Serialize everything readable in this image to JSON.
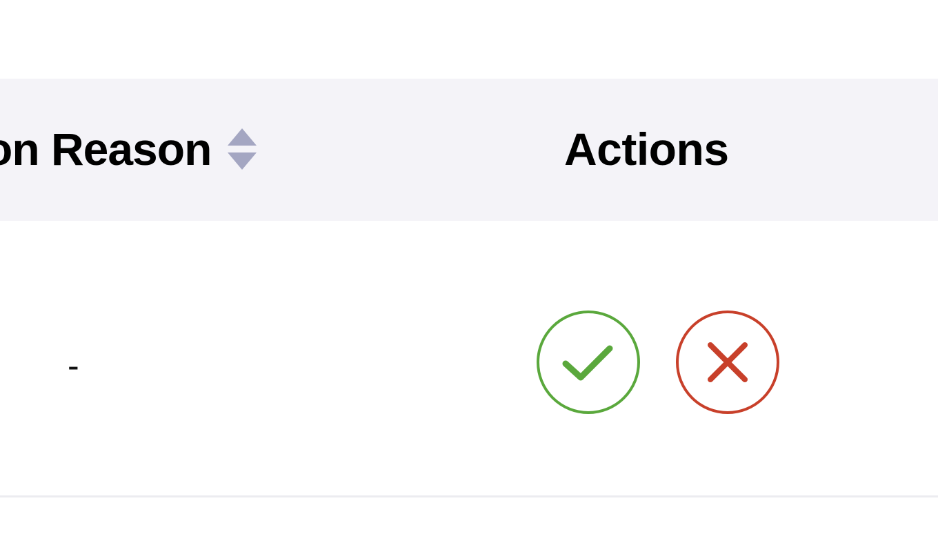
{
  "table": {
    "columns": [
      {
        "label": "on Reason",
        "sortable": true
      },
      {
        "label": "Actions",
        "sortable": false
      }
    ],
    "rows": [
      {
        "reason": "-",
        "actions": [
          {
            "name": "approve",
            "icon": "check-circle-icon",
            "color": "#5aa83c"
          },
          {
            "name": "reject",
            "icon": "x-circle-icon",
            "color": "#c8402a"
          }
        ]
      }
    ]
  },
  "colors": {
    "header_background": "#f4f3f8",
    "sort_icon": "#a4a6c2",
    "approve": "#5aa83c",
    "reject": "#c8402a"
  }
}
